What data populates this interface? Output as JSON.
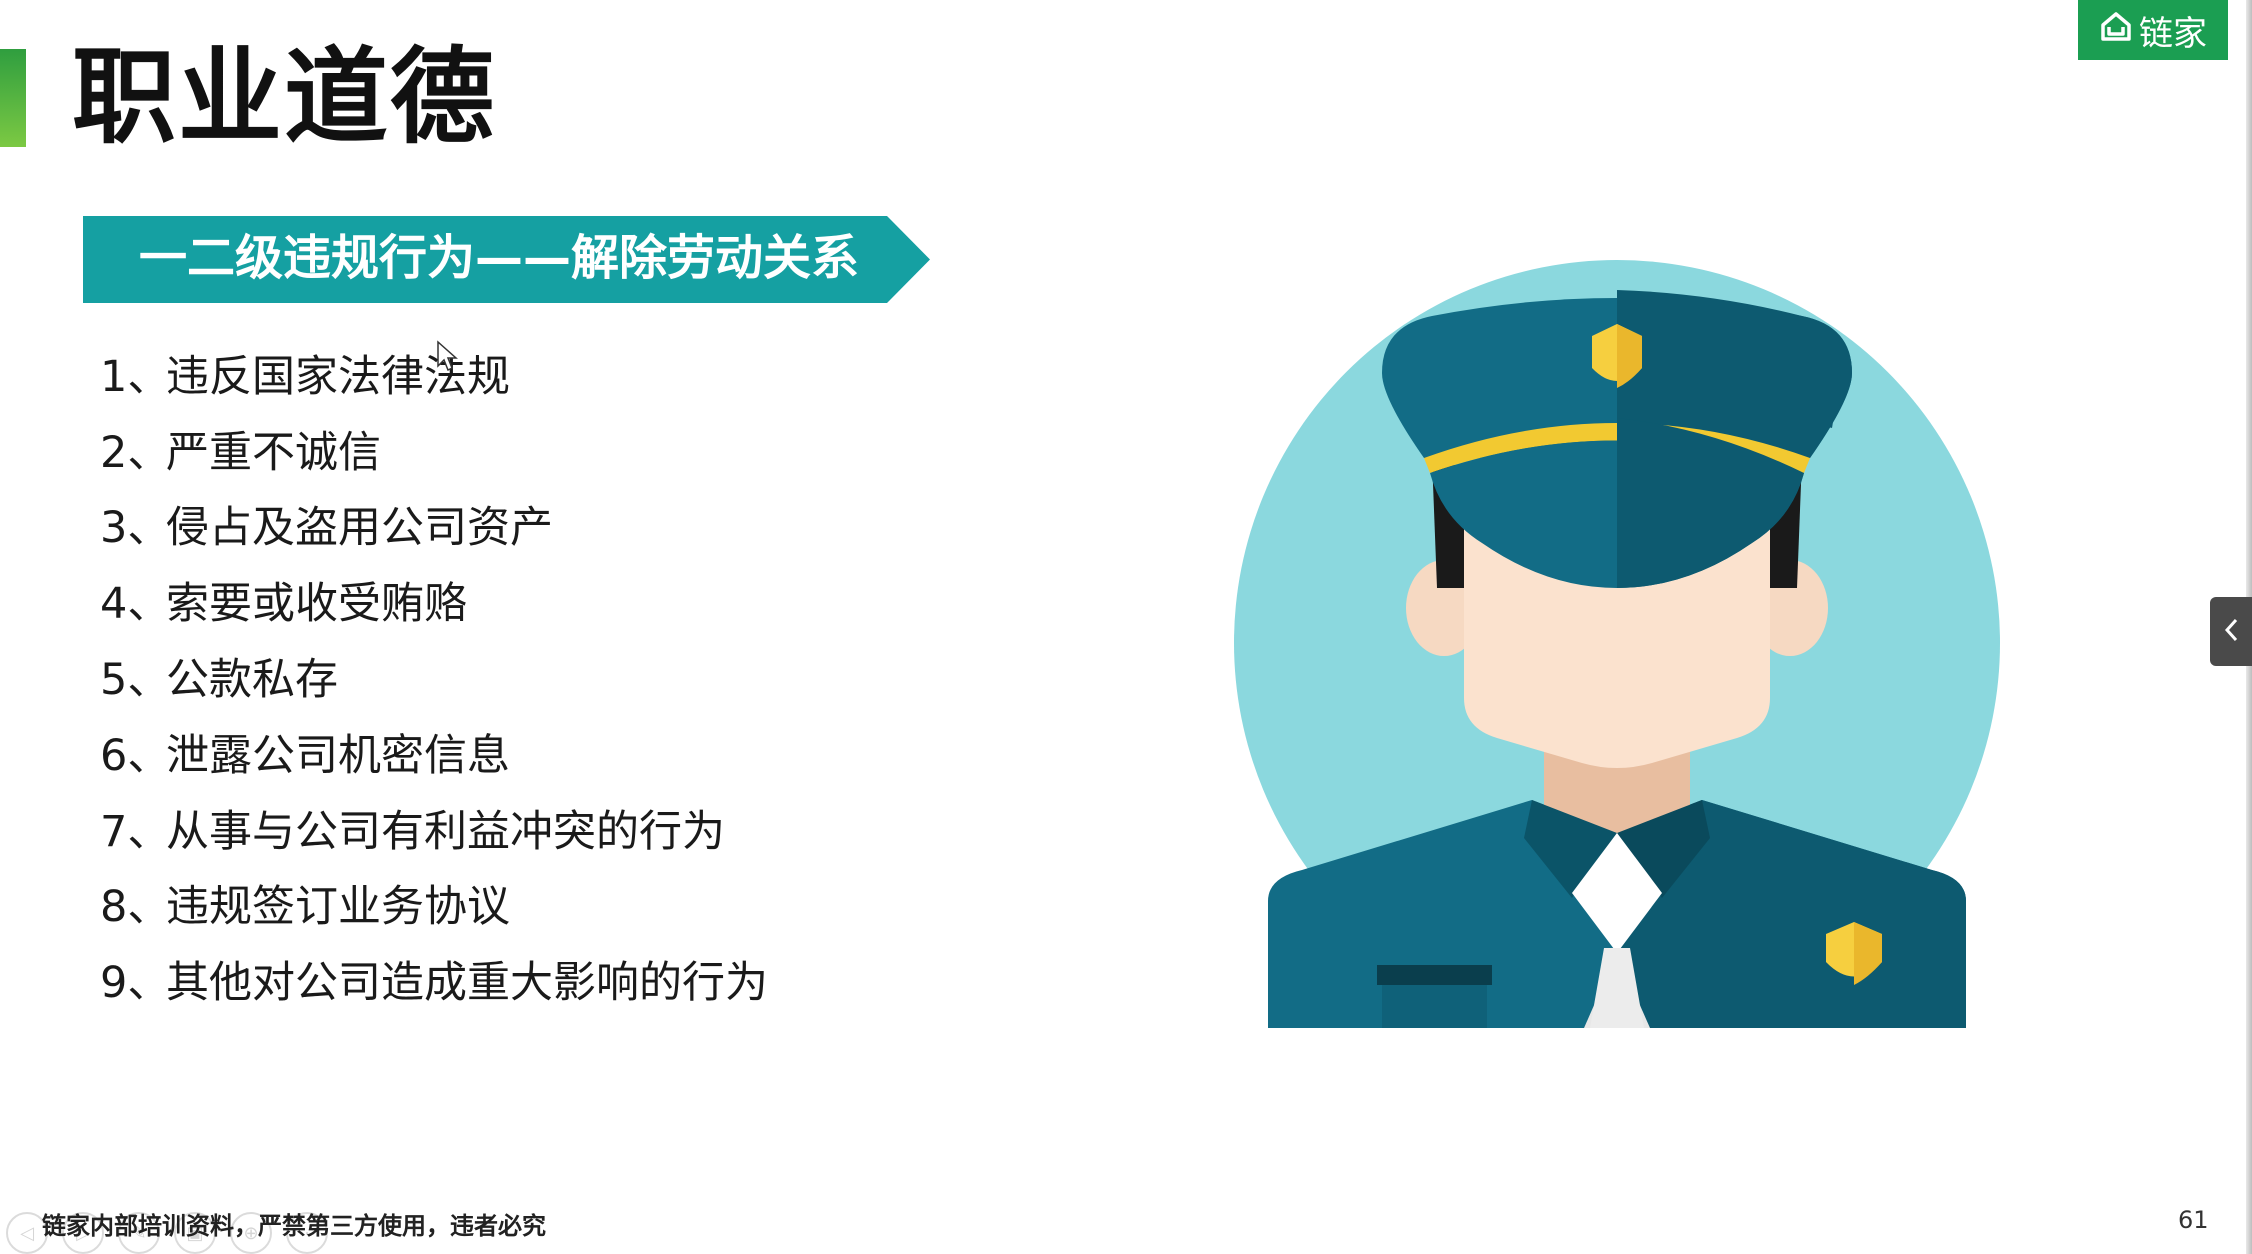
{
  "slide": {
    "title": "职业道德",
    "logo_text": "链家",
    "banner_text": "一二级违规行为——解除劳动关系",
    "rules": [
      {
        "num": "1、",
        "text": "违反国家法律法规"
      },
      {
        "num": "2、",
        "text": "严重不诚信"
      },
      {
        "num": "3、",
        "text": "侵占及盗用公司资产"
      },
      {
        "num": "4、",
        "text": "索要或收受贿赂"
      },
      {
        "num": "5、",
        "text": "公款私存"
      },
      {
        "num": "6、",
        "text": "泄露公司机密信息"
      },
      {
        "num": "7、",
        "text": "从事与公司有利益冲突的行为"
      },
      {
        "num": "8、",
        "text": "违规签订业务协议"
      },
      {
        "num": "9、",
        "text": "其他对公司造成重大影响的行为"
      }
    ],
    "footer_note": "链家内部培训资料，严禁第三方使用，违者必究",
    "page_number": "61"
  },
  "viewer": {
    "side_tab_icon": "chevron-left-icon",
    "nav_buttons": [
      "previous-icon",
      "next-icon",
      "pen-icon",
      "slides-icon",
      "zoom-icon",
      "more-icon"
    ]
  },
  "colors": {
    "brand_green": "#1b9e52",
    "banner_teal": "#15a0a2",
    "accent_green": "#2f9e3f",
    "uniform_dark": "#0f5e75",
    "circle_bg": "#8bd8de"
  }
}
